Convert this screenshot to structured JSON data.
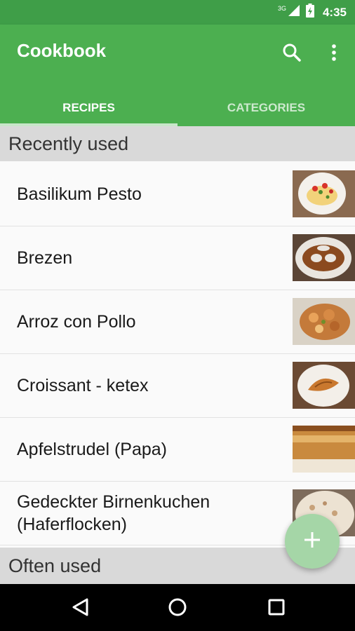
{
  "status_bar": {
    "network": "3G",
    "time": "4:35"
  },
  "app_bar": {
    "title": "Cookbook"
  },
  "icons": {
    "search": "search-icon",
    "more": "more-vert-icon",
    "add": "plus-icon",
    "back": "back-triangle-icon",
    "home": "home-circle-icon",
    "recents": "recents-square-icon"
  },
  "tabs": [
    {
      "label": "RECIPES",
      "selected": true
    },
    {
      "label": "CATEGORIES",
      "selected": false
    }
  ],
  "sections": {
    "recent": "Recently used",
    "often": "Often used"
  },
  "recipes": [
    {
      "title": "Basilikum Pesto"
    },
    {
      "title": "Brezen"
    },
    {
      "title": "Arroz con Pollo"
    },
    {
      "title": "Croissant - ketex"
    },
    {
      "title": "Apfelstrudel (Papa)"
    },
    {
      "title": "Gedeckter Birnenkuchen (Haferflocken)"
    }
  ],
  "colors": {
    "primary": "#4caf50",
    "primary_dark": "#3f9e48",
    "fab": "#a5d6a7",
    "section_bg": "#d9d9d9"
  }
}
